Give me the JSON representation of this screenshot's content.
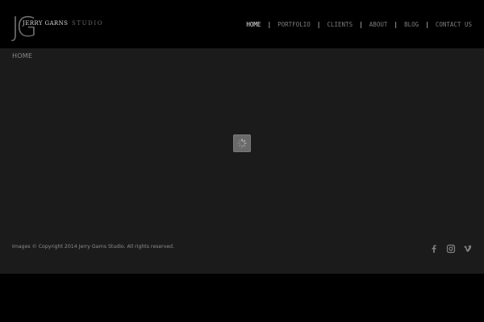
{
  "brand": {
    "mark": "JG",
    "name": "JERRY GARNS",
    "subtitle": "STUDIO"
  },
  "nav": {
    "items": [
      {
        "label": "HOME"
      },
      {
        "label": "PORTFOLIO"
      },
      {
        "label": "CLIENTS"
      },
      {
        "label": "ABOUT"
      },
      {
        "label": "BLOG"
      },
      {
        "label": "CONTACT US"
      }
    ],
    "separator": "|",
    "active": "HOME"
  },
  "page": {
    "title": "HOME"
  },
  "loader": {
    "icon": "spinner-icon"
  },
  "footer": {
    "copyright": "Images © Copyright 2014 Jerry Garns Studio. All rights reserved.",
    "social": [
      {
        "icon": "facebook-icon"
      },
      {
        "icon": "instagram-icon"
      },
      {
        "icon": "vimeo-icon"
      }
    ]
  },
  "colors": {
    "header_bg": "#000000",
    "content_bg": "#1b1b1b",
    "nav_active": "#e6e6e6",
    "nav_inactive": "#7c7c7c",
    "muted_text": "#8a8a8a"
  }
}
